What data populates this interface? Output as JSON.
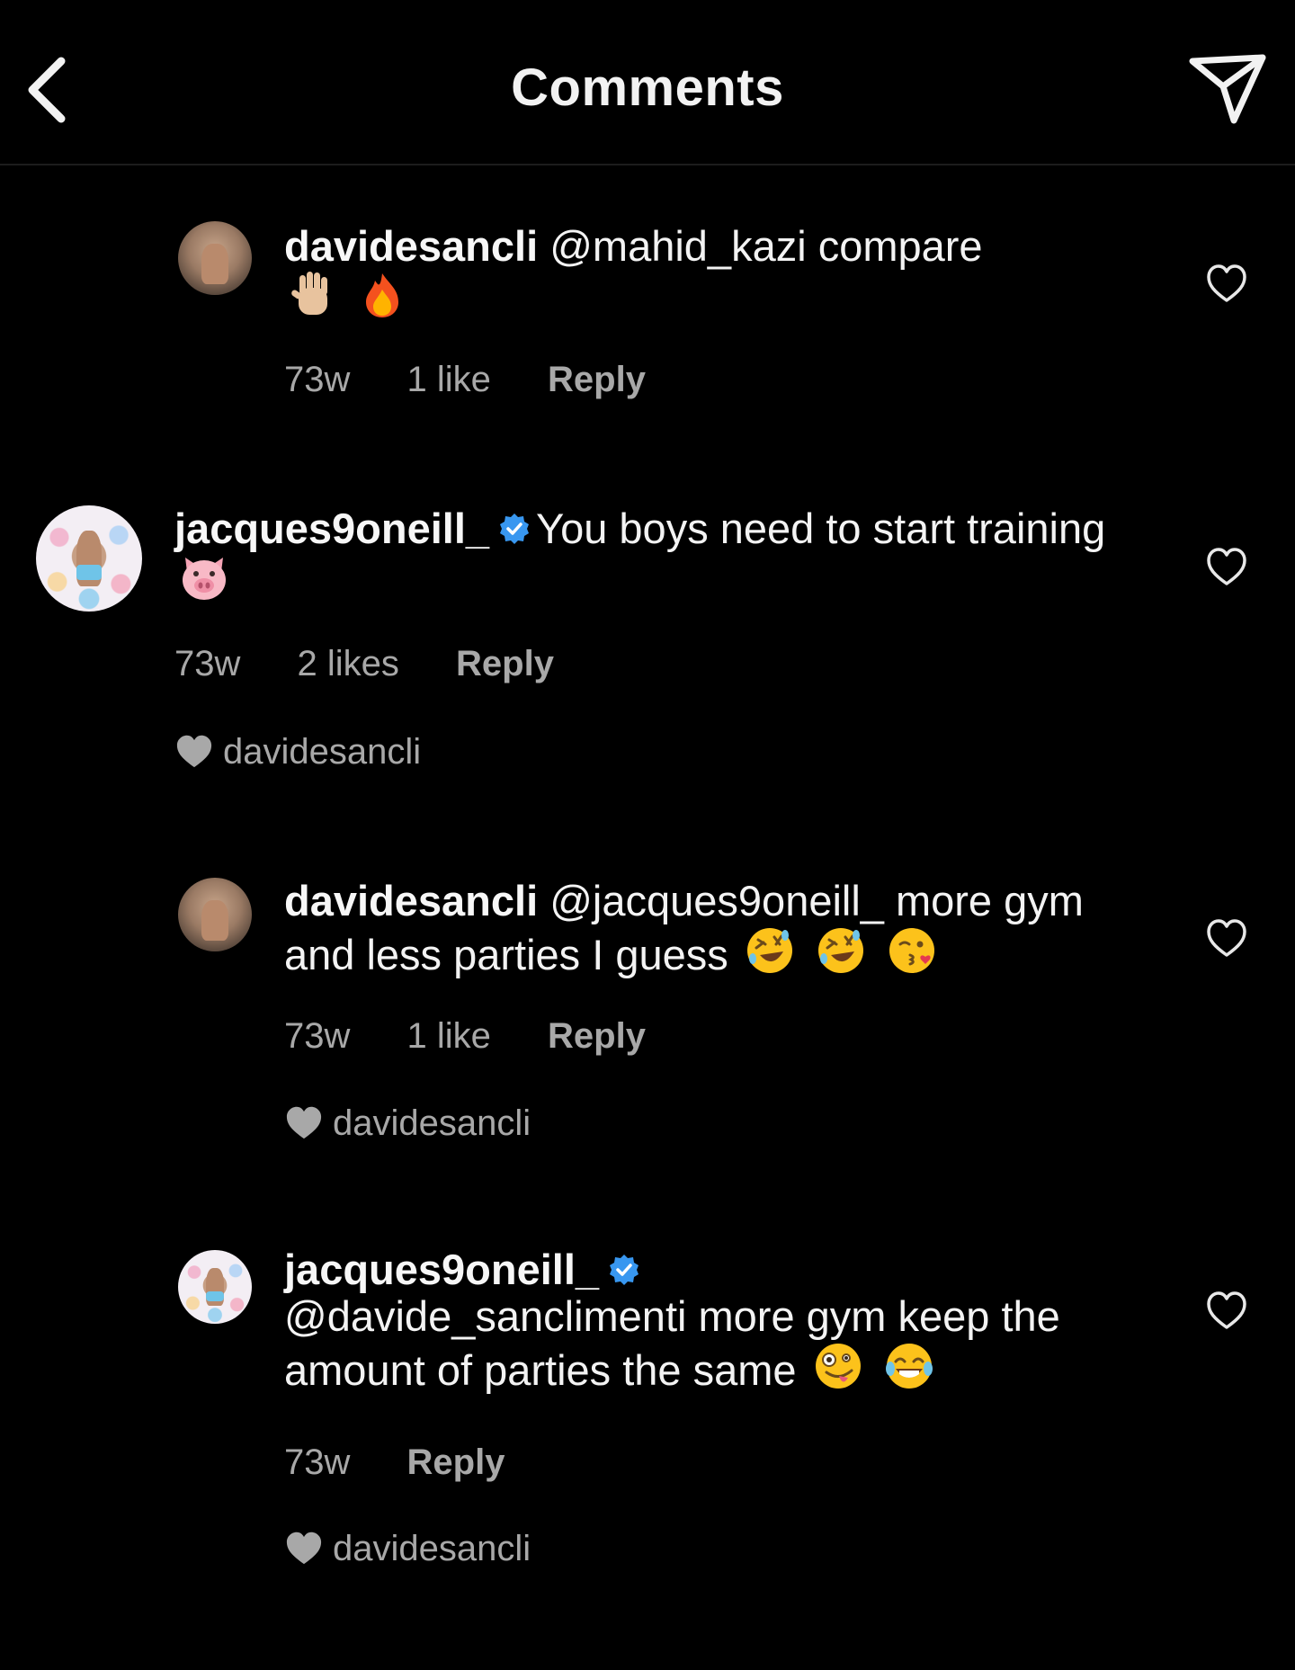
{
  "header": {
    "title": "Comments",
    "back_icon": "chevron-left-icon",
    "share_icon": "send-icon"
  },
  "comments": [
    {
      "username": "davidesancli",
      "verified": false,
      "text": "@mahid_kazi compare",
      "emojis": [
        "raised-hand-emoji",
        "fire-emoji"
      ],
      "age": "73w",
      "likes": "1 like",
      "reply_label": "Reply",
      "liked_by": ""
    },
    {
      "username": "jacques9oneill_",
      "verified": true,
      "text": "You boys need to start training",
      "emojis": [
        "pig-face-emoji"
      ],
      "age": "73w",
      "likes": "2 likes",
      "reply_label": "Reply",
      "liked_by": "davidesancli"
    },
    {
      "username": "davidesancli",
      "verified": false,
      "text": "@jacques9oneill_ more gym and less parties I guess",
      "emojis": [
        "rolling-laughing-emoji",
        "rolling-laughing-emoji",
        "kissing-wink-emoji"
      ],
      "age": "73w",
      "likes": "1 like",
      "reply_label": "Reply",
      "liked_by": "davidesancli"
    },
    {
      "username": "jacques9oneill_",
      "verified": true,
      "text": "@davide_sanclimenti more gym keep the amount of parties the same",
      "emojis": [
        "zany-face-emoji",
        "tears-of-joy-emoji"
      ],
      "age": "73w",
      "likes": "",
      "reply_label": "Reply",
      "liked_by": "davidesancli"
    }
  ],
  "colors": {
    "background": "#000000",
    "text": "#f3f3f3",
    "secondary": "#a8a8a8",
    "verified": "#3897f0"
  }
}
